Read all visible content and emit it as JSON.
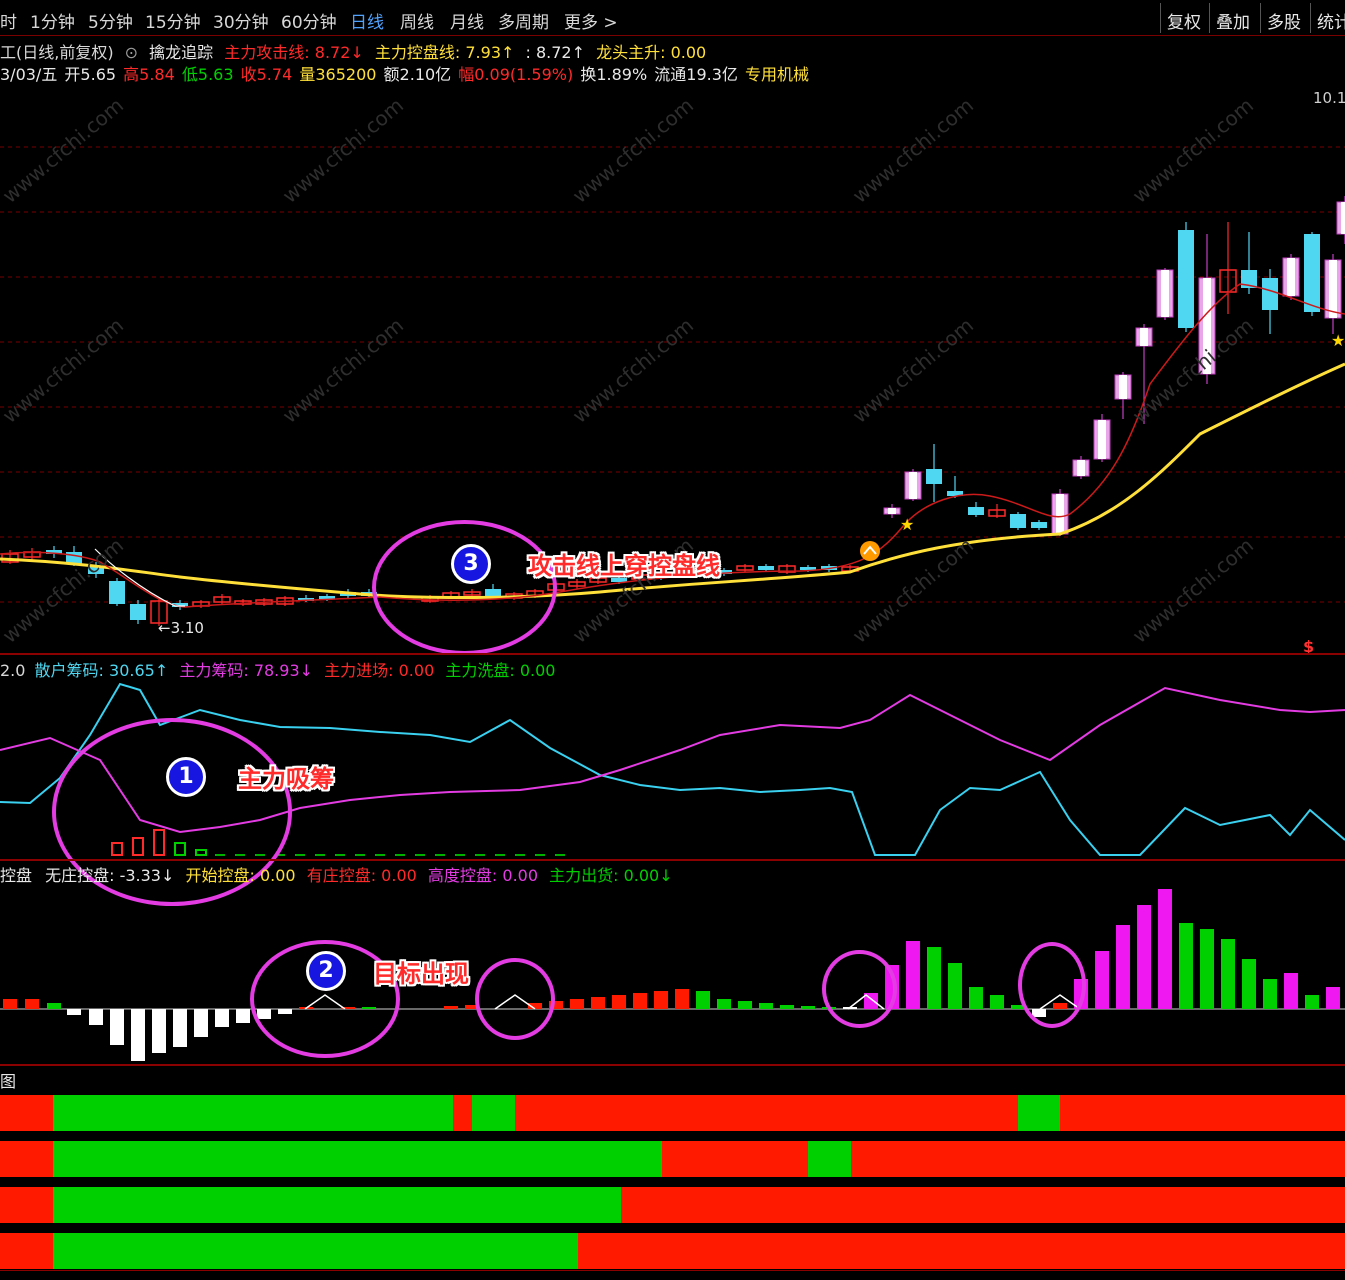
{
  "toolbar": {
    "periods": [
      "时",
      "1分钟",
      "5分钟",
      "15分钟",
      "30分钟",
      "60分钟",
      "日线",
      "周线",
      "月线",
      "多周期",
      "更多 >"
    ],
    "active_period": "日线",
    "right_buttons": [
      "复权",
      "叠加",
      "多股",
      "统计"
    ]
  },
  "main_info": {
    "chart_name": "工(日线,前复权)",
    "indicator_name": "擒龙追踪",
    "attack_label": "主力攻击线: 8.72↓",
    "control_label": "主力控盘线: 7.93↑",
    "extra_label": ": 8.72↑",
    "dragon_label": "龙头主升: 0.00"
  },
  "quote": {
    "date": "3/03/五",
    "open": "开5.65",
    "high": "高5.84",
    "low": "低5.63",
    "close": "收5.74",
    "volume": "量365200",
    "amount": "额2.10亿",
    "change": "幅0.09(1.59%)",
    "turnover": "换1.89%",
    "float": "流通19.3亿",
    "sector": "专用机械"
  },
  "axis": {
    "top_value": "10.1",
    "low_value": "←3.10"
  },
  "panel2": {
    "prefix": "2.0",
    "retail": "散户筹码: 30.65↑",
    "main": "主力筹码: 78.93↓",
    "enter": "主力进场: 0.00",
    "wash": "主力洗盘: 0.00"
  },
  "panel3": {
    "prefix": "控盘",
    "none": "无庄控盘: -3.33↓",
    "start": "开始控盘: 0.00",
    "has": "有庄控盘: 0.00",
    "high": "高度控盘: 0.00",
    "ship": "主力出货: 0.00↓"
  },
  "panel4": {
    "prefix": "图"
  },
  "annotations": {
    "badge1": "1",
    "label1": "主力吸筹",
    "badge2": "2",
    "label2": "目标出现",
    "badge3": "3",
    "label3": "攻击线上穿控盘线"
  },
  "colors": {
    "up": "#ff2a2a",
    "down": "#4fd6f0",
    "pink": "#e33ce3",
    "yellow": "#ffe03a",
    "green": "#00d000",
    "red": "#ff1a00",
    "white": "#ffffff"
  },
  "bars_panel4": [
    [
      [
        "r",
        0,
        53
      ],
      [
        "g",
        53,
        453
      ],
      [
        "r",
        453,
        472
      ],
      [
        "g",
        472,
        515
      ],
      [
        "r",
        515,
        1018
      ],
      [
        "g",
        1018,
        1060
      ],
      [
        "r",
        1060,
        1345
      ]
    ],
    [
      [
        "r",
        0,
        53
      ],
      [
        "g",
        53,
        662
      ],
      [
        "r",
        662,
        808
      ],
      [
        "g",
        808,
        851
      ],
      [
        "r",
        851,
        1345
      ]
    ],
    [
      [
        "r",
        0,
        53
      ],
      [
        "g",
        53,
        621
      ],
      [
        "r",
        621,
        1345
      ]
    ],
    [
      [
        "r",
        0,
        53
      ],
      [
        "g",
        53,
        578
      ],
      [
        "r",
        578,
        1345
      ]
    ]
  ]
}
